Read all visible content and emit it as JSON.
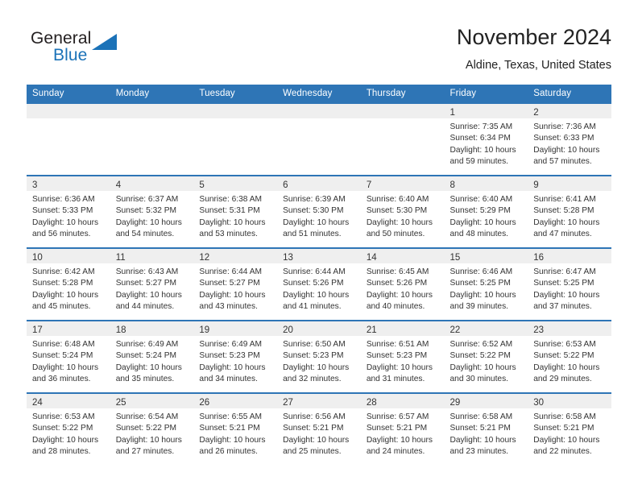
{
  "brand": {
    "name_part1": "General",
    "name_part2": "Blue",
    "triangle_color": "#1b72b8",
    "text_color": "#231f20"
  },
  "header": {
    "title": "November 2024",
    "location": "Aldine, Texas, United States"
  },
  "colors": {
    "header_blue": "#2e75b6",
    "day_band_gray": "#efefef",
    "text": "#333333"
  },
  "weekday_headers": [
    "Sunday",
    "Monday",
    "Tuesday",
    "Wednesday",
    "Thursday",
    "Friday",
    "Saturday"
  ],
  "weeks": [
    [
      {
        "empty": true
      },
      {
        "empty": true
      },
      {
        "empty": true
      },
      {
        "empty": true
      },
      {
        "empty": true
      },
      {
        "day": "1",
        "sunrise": "Sunrise: 7:35 AM",
        "sunset": "Sunset: 6:34 PM",
        "daylight": "Daylight: 10 hours and 59 minutes."
      },
      {
        "day": "2",
        "sunrise": "Sunrise: 7:36 AM",
        "sunset": "Sunset: 6:33 PM",
        "daylight": "Daylight: 10 hours and 57 minutes."
      }
    ],
    [
      {
        "day": "3",
        "sunrise": "Sunrise: 6:36 AM",
        "sunset": "Sunset: 5:33 PM",
        "daylight": "Daylight: 10 hours and 56 minutes."
      },
      {
        "day": "4",
        "sunrise": "Sunrise: 6:37 AM",
        "sunset": "Sunset: 5:32 PM",
        "daylight": "Daylight: 10 hours and 54 minutes."
      },
      {
        "day": "5",
        "sunrise": "Sunrise: 6:38 AM",
        "sunset": "Sunset: 5:31 PM",
        "daylight": "Daylight: 10 hours and 53 minutes."
      },
      {
        "day": "6",
        "sunrise": "Sunrise: 6:39 AM",
        "sunset": "Sunset: 5:30 PM",
        "daylight": "Daylight: 10 hours and 51 minutes."
      },
      {
        "day": "7",
        "sunrise": "Sunrise: 6:40 AM",
        "sunset": "Sunset: 5:30 PM",
        "daylight": "Daylight: 10 hours and 50 minutes."
      },
      {
        "day": "8",
        "sunrise": "Sunrise: 6:40 AM",
        "sunset": "Sunset: 5:29 PM",
        "daylight": "Daylight: 10 hours and 48 minutes."
      },
      {
        "day": "9",
        "sunrise": "Sunrise: 6:41 AM",
        "sunset": "Sunset: 5:28 PM",
        "daylight": "Daylight: 10 hours and 47 minutes."
      }
    ],
    [
      {
        "day": "10",
        "sunrise": "Sunrise: 6:42 AM",
        "sunset": "Sunset: 5:28 PM",
        "daylight": "Daylight: 10 hours and 45 minutes."
      },
      {
        "day": "11",
        "sunrise": "Sunrise: 6:43 AM",
        "sunset": "Sunset: 5:27 PM",
        "daylight": "Daylight: 10 hours and 44 minutes."
      },
      {
        "day": "12",
        "sunrise": "Sunrise: 6:44 AM",
        "sunset": "Sunset: 5:27 PM",
        "daylight": "Daylight: 10 hours and 43 minutes."
      },
      {
        "day": "13",
        "sunrise": "Sunrise: 6:44 AM",
        "sunset": "Sunset: 5:26 PM",
        "daylight": "Daylight: 10 hours and 41 minutes."
      },
      {
        "day": "14",
        "sunrise": "Sunrise: 6:45 AM",
        "sunset": "Sunset: 5:26 PM",
        "daylight": "Daylight: 10 hours and 40 minutes."
      },
      {
        "day": "15",
        "sunrise": "Sunrise: 6:46 AM",
        "sunset": "Sunset: 5:25 PM",
        "daylight": "Daylight: 10 hours and 39 minutes."
      },
      {
        "day": "16",
        "sunrise": "Sunrise: 6:47 AM",
        "sunset": "Sunset: 5:25 PM",
        "daylight": "Daylight: 10 hours and 37 minutes."
      }
    ],
    [
      {
        "day": "17",
        "sunrise": "Sunrise: 6:48 AM",
        "sunset": "Sunset: 5:24 PM",
        "daylight": "Daylight: 10 hours and 36 minutes."
      },
      {
        "day": "18",
        "sunrise": "Sunrise: 6:49 AM",
        "sunset": "Sunset: 5:24 PM",
        "daylight": "Daylight: 10 hours and 35 minutes."
      },
      {
        "day": "19",
        "sunrise": "Sunrise: 6:49 AM",
        "sunset": "Sunset: 5:23 PM",
        "daylight": "Daylight: 10 hours and 34 minutes."
      },
      {
        "day": "20",
        "sunrise": "Sunrise: 6:50 AM",
        "sunset": "Sunset: 5:23 PM",
        "daylight": "Daylight: 10 hours and 32 minutes."
      },
      {
        "day": "21",
        "sunrise": "Sunrise: 6:51 AM",
        "sunset": "Sunset: 5:23 PM",
        "daylight": "Daylight: 10 hours and 31 minutes."
      },
      {
        "day": "22",
        "sunrise": "Sunrise: 6:52 AM",
        "sunset": "Sunset: 5:22 PM",
        "daylight": "Daylight: 10 hours and 30 minutes."
      },
      {
        "day": "23",
        "sunrise": "Sunrise: 6:53 AM",
        "sunset": "Sunset: 5:22 PM",
        "daylight": "Daylight: 10 hours and 29 minutes."
      }
    ],
    [
      {
        "day": "24",
        "sunrise": "Sunrise: 6:53 AM",
        "sunset": "Sunset: 5:22 PM",
        "daylight": "Daylight: 10 hours and 28 minutes."
      },
      {
        "day": "25",
        "sunrise": "Sunrise: 6:54 AM",
        "sunset": "Sunset: 5:22 PM",
        "daylight": "Daylight: 10 hours and 27 minutes."
      },
      {
        "day": "26",
        "sunrise": "Sunrise: 6:55 AM",
        "sunset": "Sunset: 5:21 PM",
        "daylight": "Daylight: 10 hours and 26 minutes."
      },
      {
        "day": "27",
        "sunrise": "Sunrise: 6:56 AM",
        "sunset": "Sunset: 5:21 PM",
        "daylight": "Daylight: 10 hours and 25 minutes."
      },
      {
        "day": "28",
        "sunrise": "Sunrise: 6:57 AM",
        "sunset": "Sunset: 5:21 PM",
        "daylight": "Daylight: 10 hours and 24 minutes."
      },
      {
        "day": "29",
        "sunrise": "Sunrise: 6:58 AM",
        "sunset": "Sunset: 5:21 PM",
        "daylight": "Daylight: 10 hours and 23 minutes."
      },
      {
        "day": "30",
        "sunrise": "Sunrise: 6:58 AM",
        "sunset": "Sunset: 5:21 PM",
        "daylight": "Daylight: 10 hours and 22 minutes."
      }
    ]
  ]
}
